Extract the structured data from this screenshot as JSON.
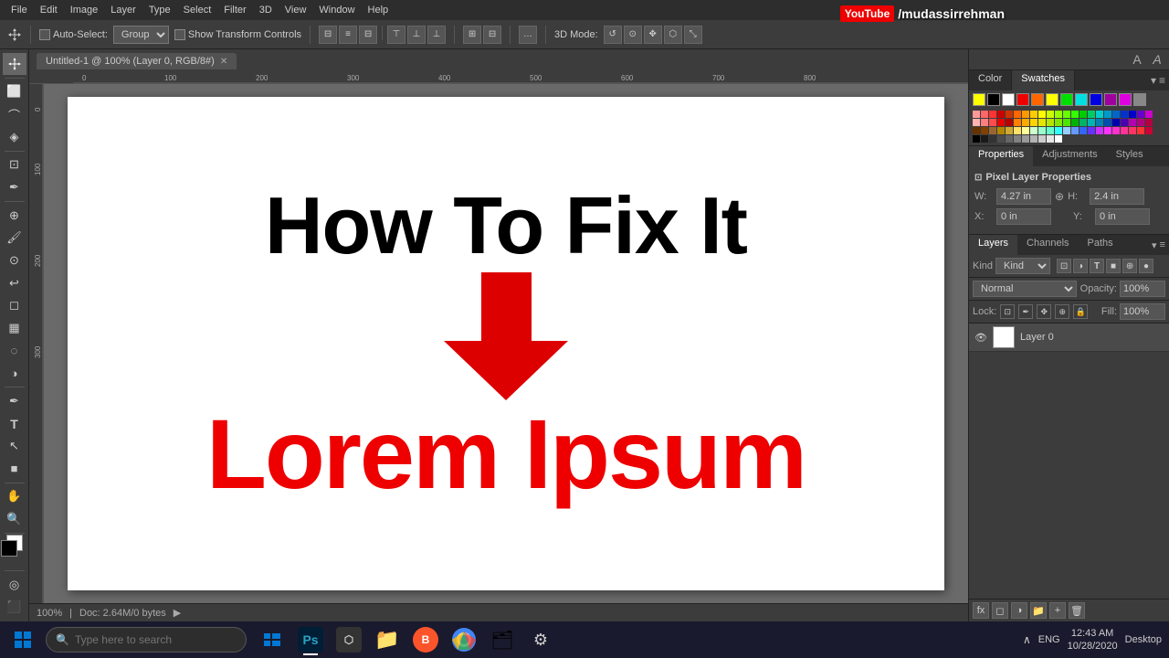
{
  "window": {
    "title": "Photoshop",
    "tab_title": "Untitled-1 @ 100% (Layer 0, RGB/8#)"
  },
  "menu": {
    "items": [
      "File",
      "Edit",
      "Image",
      "Layer",
      "Type",
      "Select",
      "Filter",
      "3D",
      "View",
      "Window",
      "Help"
    ]
  },
  "toolbar": {
    "auto_select_label": "Auto-Select:",
    "auto_select_dropdown": "Group",
    "show_transform_label": "Show Transform Controls",
    "three_d_mode_label": "3D Mode:",
    "mode_icons": [
      "align-left",
      "align-center",
      "align-right",
      "align-top",
      "align-middle",
      "align-bottom"
    ],
    "distribute_icons": [
      "dist-h",
      "dist-v"
    ],
    "more_icon": "..."
  },
  "canvas": {
    "title_text": "How To Fix It",
    "subtitle_text": "Lorem Ipsum",
    "arrow_color": "#dd0000",
    "title_color": "#000000",
    "subtitle_color": "#dd0000"
  },
  "youtube_watermark": {
    "logo": "YouTube",
    "channel": "/mudassirrehman"
  },
  "properties_panel": {
    "tabs": [
      "Properties",
      "Adjustments",
      "Styles"
    ],
    "active_tab": "Properties",
    "layer_properties_label": "Pixel Layer Properties",
    "fields": {
      "W_label": "W:",
      "W_value": "4.27 in",
      "H_label": "H:",
      "H_value": "2.4 in",
      "X_label": "X:",
      "X_value": "0 in",
      "Y_label": "Y:",
      "Y_value": "0 in"
    }
  },
  "layers_panel": {
    "tabs": [
      "Layers",
      "Channels",
      "Paths"
    ],
    "active_tab": "Layers",
    "filter_label": "Kind",
    "mode": "Normal",
    "opacity_label": "Opacity:",
    "opacity_value": "100%",
    "lock_label": "Lock:",
    "fill_label": "Fill:",
    "fill_value": "100%",
    "layers": [
      {
        "name": "Layer 0",
        "visible": true
      }
    ],
    "bottom_buttons": [
      "fx",
      "mask",
      "adjustment",
      "group",
      "new",
      "delete"
    ]
  },
  "status_bar": {
    "zoom": "100%",
    "doc_info": "Doc: 2.64M/0 bytes",
    "arrow": "▶"
  },
  "taskbar": {
    "search_placeholder": "Type here to search",
    "apps": [
      {
        "id": "task-view",
        "label": "⊞",
        "color": "#0078d4"
      },
      {
        "id": "photoshop",
        "label": "Ps",
        "color": "#2da0c3"
      },
      {
        "id": "media",
        "label": "⊡",
        "color": "#555"
      },
      {
        "id": "folder",
        "label": "📁",
        "color": "#f0a830"
      },
      {
        "id": "brave",
        "label": "B",
        "color": "#e55"
      },
      {
        "id": "chrome",
        "label": "◉",
        "color": "#4caf50"
      },
      {
        "id": "explorer",
        "label": "🗂",
        "color": "#0078d4"
      },
      {
        "id": "settings",
        "label": "⚙",
        "color": "#888"
      }
    ],
    "right_items": [
      "∧",
      "ENG",
      "12:43 AM\n10/28/2020",
      "Desktop"
    ],
    "time": "12:43 AM",
    "date": "10/28/2020"
  },
  "swatches": {
    "colors": [
      "#ffffff",
      "#000000",
      "#ff0000",
      "#ff6600",
      "#ffff00",
      "#00ff00",
      "#00ffff",
      "#0000ff",
      "#ff00ff",
      "#888888",
      "#ffcccc",
      "#ff9999",
      "#ff6666",
      "#ff3333",
      "#cc0000",
      "#cc3300",
      "#cc6600",
      "#cc9900",
      "#cccc00",
      "#99cc00",
      "#66cc00",
      "#33cc00",
      "#00cc00",
      "#00cc33",
      "#00cc66",
      "#00cc99",
      "#00cccc",
      "#00ccff"
    ]
  },
  "lock_icons": [
    "🔒",
    "✎",
    "↔",
    "⊕",
    "🔒"
  ],
  "right_panel_icons": [
    "A",
    "A"
  ]
}
